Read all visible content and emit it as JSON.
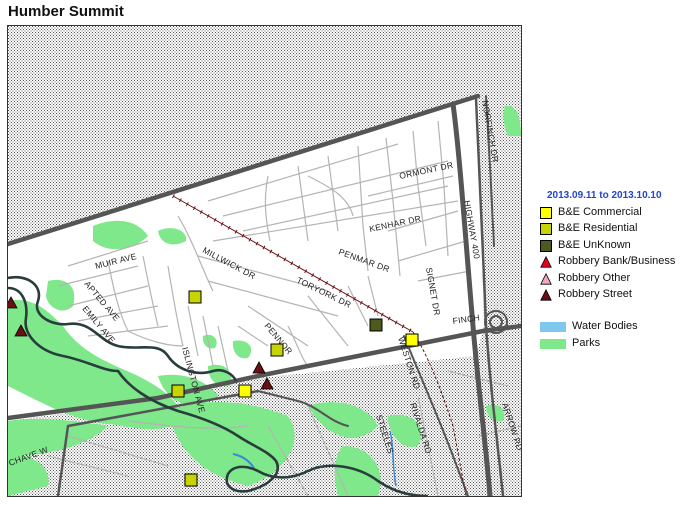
{
  "title": "Humber Summit",
  "legend": {
    "date_range": "2013.09.11 to 2013.10.10",
    "crime_types": [
      {
        "label": "B&E Commercial",
        "shape": "square",
        "color": "#ffff00"
      },
      {
        "label": "B&E Residential",
        "shape": "square",
        "color": "#c8d400"
      },
      {
        "label": "B&E UnKnown",
        "shape": "square",
        "color": "#4d5a1e"
      },
      {
        "label": "Robbery Bank/Business",
        "shape": "triangle",
        "color": "#e8001c"
      },
      {
        "label": "Robbery Other",
        "shape": "triangle",
        "color": "#f4a8bc"
      },
      {
        "label": "Robbery Street",
        "shape": "triangle",
        "color": "#6b0f12"
      }
    ],
    "layers": [
      {
        "label": "Water Bodies",
        "color": "#7ec8f0"
      },
      {
        "label": "Parks",
        "color": "#7ee88a"
      }
    ]
  },
  "map": {
    "street_labels": [
      "ORMONT DR",
      "KENHAR DR",
      "PENMAR DR",
      "SIGNET DR",
      "MILLWICK DR",
      "TORYORK DR",
      "MUIR AVE",
      "APTED AVE",
      "EMILY AVE",
      "PENNOR",
      "ISLINGTON AVE",
      "WESTON RD",
      "FINCH",
      "HIGHWAY 400",
      "NORFINCH DR",
      "RIVALDA RD",
      "STEELES",
      "CHAVE W",
      "ARROW RD"
    ]
  }
}
